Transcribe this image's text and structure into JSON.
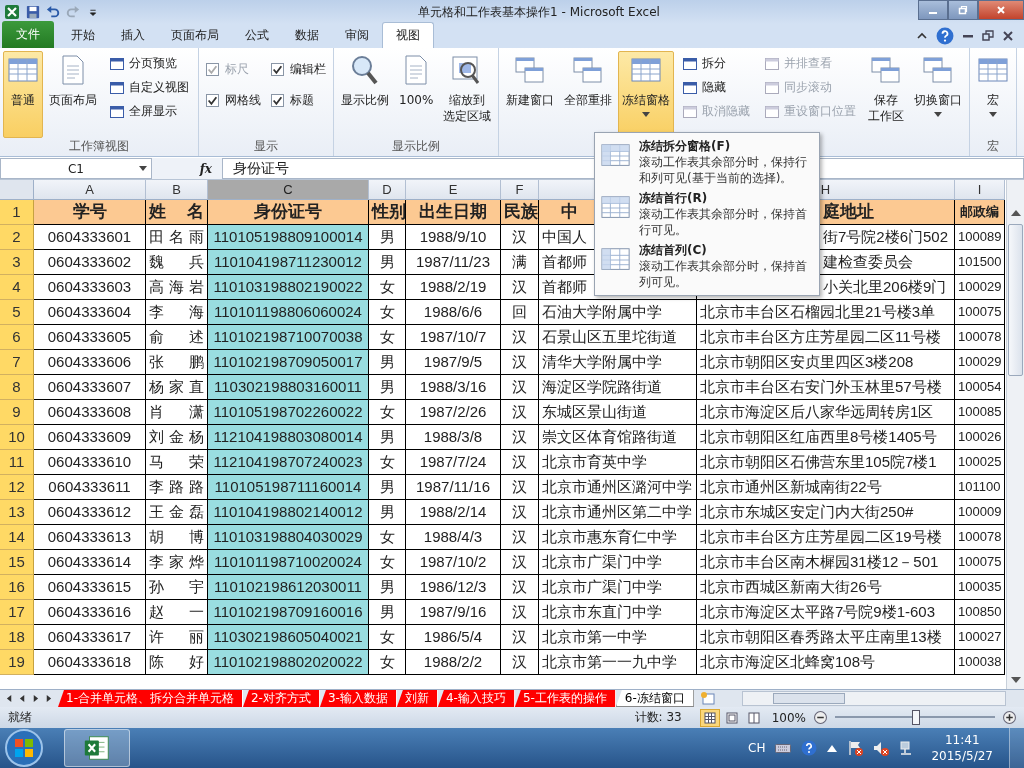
{
  "window": {
    "title": "单元格和工作表基本操作1 - Microsoft Excel"
  },
  "ribbon_tabs": [
    {
      "label": "文件",
      "kind": "file",
      "selected": false
    },
    {
      "label": "开始",
      "kind": "tab",
      "selected": false
    },
    {
      "label": "插入",
      "kind": "tab",
      "selected": false
    },
    {
      "label": "页面布局",
      "kind": "tab",
      "selected": false
    },
    {
      "label": "公式",
      "kind": "tab",
      "selected": false
    },
    {
      "label": "数据",
      "kind": "tab",
      "selected": false
    },
    {
      "label": "审阅",
      "kind": "tab",
      "selected": false
    },
    {
      "label": "视图",
      "kind": "tab",
      "selected": true
    }
  ],
  "ribbon_groups": [
    {
      "label": "工作簿视图",
      "items": [
        {
          "kind": "large",
          "label": "普通",
          "selected": true
        },
        {
          "kind": "large",
          "label": "页面布局",
          "selected": false
        },
        {
          "kind": "stack",
          "items": [
            {
              "label": "分页预览",
              "disabled": false
            },
            {
              "label": "自定义视图",
              "disabled": false
            },
            {
              "label": "全屏显示",
              "disabled": false
            }
          ]
        }
      ]
    },
    {
      "label": "显示",
      "items": [
        {
          "kind": "checks",
          "items": [
            {
              "label": "标尺",
              "checked": true,
              "disabled": true
            },
            {
              "label": "网格线",
              "checked": true,
              "disabled": false
            }
          ]
        },
        {
          "kind": "checks",
          "items": [
            {
              "label": "编辑栏",
              "checked": true,
              "disabled": false
            },
            {
              "label": "标题",
              "checked": true,
              "disabled": false
            }
          ]
        }
      ]
    },
    {
      "label": "显示比例",
      "items": [
        {
          "kind": "large",
          "label": "显示比例",
          "selected": false
        },
        {
          "kind": "large",
          "label": "100%",
          "selected": false
        },
        {
          "kind": "large",
          "label": "缩放到选定区域",
          "selected": false
        }
      ]
    },
    {
      "items": [
        {
          "kind": "large",
          "label": "新建窗口",
          "selected": false
        },
        {
          "kind": "large",
          "label": "全部重排",
          "selected": false
        },
        {
          "kind": "large",
          "label": "冻结窗格",
          "selected": true,
          "dropdown": true
        },
        {
          "kind": "stack",
          "items": [
            {
              "label": "拆分",
              "disabled": false
            },
            {
              "label": "隐藏",
              "disabled": false
            },
            {
              "label": "取消隐藏",
              "disabled": true
            }
          ]
        },
        {
          "kind": "stack",
          "items": [
            {
              "label": "并排查看",
              "disabled": true
            },
            {
              "label": "同步滚动",
              "disabled": true
            },
            {
              "label": "重设窗口位置",
              "disabled": true
            }
          ]
        },
        {
          "kind": "large",
          "label": "保存工作区",
          "selected": false
        },
        {
          "kind": "large",
          "label": "切换窗口",
          "selected": false,
          "dropdown": true
        }
      ]
    },
    {
      "label": "宏",
      "items": [
        {
          "kind": "large",
          "label": "宏",
          "selected": false,
          "dropdown": true
        }
      ]
    }
  ],
  "formula_bar": {
    "name_box": "C1",
    "fx": "fx",
    "value": "身份证号"
  },
  "freeze_menu": [
    {
      "title": "冻结拆分窗格(F)",
      "description": "滚动工作表其余部分时，保持行和列可见(基于当前的选择)。"
    },
    {
      "title": "冻结首行(R)",
      "description": "滚动工作表其余部分时，保持首行可见。"
    },
    {
      "title": "冻结首列(C)",
      "description": "滚动工作表其余部分时，保持首列可见。"
    }
  ],
  "sheet": {
    "columns": [
      {
        "label": "A",
        "selected": false
      },
      {
        "label": "B",
        "selected": false
      },
      {
        "label": "C",
        "selected": true
      },
      {
        "label": "D",
        "selected": false
      },
      {
        "label": "E",
        "selected": false
      },
      {
        "label": "F",
        "selected": false
      },
      {
        "selected": false
      },
      {
        "label": "H",
        "selected": false
      },
      {
        "label": "I",
        "selected": false
      }
    ],
    "rows": [
      {
        "number": "1",
        "kind": "header",
        "cells": [
          "学号",
          "姓名",
          "身份证号",
          "性别",
          "出生日期",
          "民族",
          "中",
          "庭地址",
          "邮政编"
        ]
      },
      {
        "number": "2",
        "kind": "data",
        "cells": [
          "0604333601",
          "田名雨",
          "110105198809100014",
          "男",
          "1988/9/10",
          "汉",
          "中国人",
          "街7号院2楼6门502",
          "100089"
        ]
      },
      {
        "number": "3",
        "kind": "data",
        "cells": [
          "0604333602",
          "魏兵",
          "110104198711230012",
          "男",
          "1987/11/23",
          "满",
          "首都师",
          "建检查委员会",
          "101500"
        ]
      },
      {
        "number": "4",
        "kind": "data",
        "cells": [
          "0604333603",
          "高海岩",
          "110103198802190022",
          "女",
          "1988/2/19",
          "汉",
          "首都师",
          "小关北里206楼9门",
          "100029"
        ]
      },
      {
        "number": "5",
        "kind": "data",
        "cells": [
          "0604333604",
          "李海",
          "110101198806060024",
          "女",
          "1988/6/6",
          "回",
          "石油大学附属中学",
          "北京市丰台区石榴园北里21号楼3单",
          "100075"
        ]
      },
      {
        "number": "6",
        "kind": "data",
        "cells": [
          "0604333605",
          "俞述",
          "110102198710070038",
          "女",
          "1987/10/7",
          "汉",
          "石景山区五里坨街道",
          "北京市丰台区方庄芳星园二区11号楼",
          "100078"
        ]
      },
      {
        "number": "7",
        "kind": "data",
        "cells": [
          "0604333606",
          "张鹏",
          "110102198709050017",
          "男",
          "1987/9/5",
          "汉",
          "清华大学附属中学",
          "北京市朝阳区安贞里四区3楼208",
          "100029"
        ]
      },
      {
        "number": "8",
        "kind": "data",
        "cells": [
          "0604333607",
          "杨家直",
          "110302198803160011",
          "男",
          "1988/3/16",
          "汉",
          "海淀区学院路街道",
          "北京市丰台区右安门外玉林里57号楼",
          "100054"
        ]
      },
      {
        "number": "9",
        "kind": "data",
        "cells": [
          "0604333608",
          "肖潇",
          "110105198702260022",
          "女",
          "1987/2/26",
          "汉",
          "东城区景山街道",
          "北京市海淀区后八家华远周转房1区",
          "100085"
        ]
      },
      {
        "number": "10",
        "kind": "data",
        "cells": [
          "0604333609",
          "刘金杨",
          "112104198803080014",
          "男",
          "1988/3/8",
          "汉",
          "崇文区体育馆路街道",
          "北京市朝阳区红庙西里8号楼1405号",
          "100026"
        ]
      },
      {
        "number": "11",
        "kind": "data",
        "cells": [
          "0604333610",
          "马荣",
          "112104198707240023",
          "女",
          "1987/7/24",
          "汉",
          "北京市育英中学",
          "北京市朝阳区石佛营东里105院7楼1",
          "100025"
        ]
      },
      {
        "number": "12",
        "kind": "data",
        "cells": [
          "0604333611",
          "李路路",
          "110105198711160014",
          "男",
          "1987/11/16",
          "汉",
          "北京市通州区潞河中学",
          "北京市通州区新城南街22号",
          "101100"
        ]
      },
      {
        "number": "13",
        "kind": "data",
        "cells": [
          "0604333612",
          "王金磊",
          "110104198802140012",
          "男",
          "1988/2/14",
          "汉",
          "北京市通州区第二中学",
          "北京市东城区安定门内大街250#",
          "100009"
        ]
      },
      {
        "number": "14",
        "kind": "data",
        "cells": [
          "0604333613",
          "胡博",
          "110103198804030029",
          "女",
          "1988/4/3",
          "汉",
          "北京市惠东育仁中学",
          "北京市丰台区方庄芳星园二区19号楼",
          "100078"
        ]
      },
      {
        "number": "15",
        "kind": "data",
        "cells": [
          "0604333614",
          "李家烨",
          "110101198710020024",
          "女",
          "1987/10/2",
          "汉",
          "北京市广渠门中学",
          "北京市丰台区南木樨园31楼12－501",
          "100075"
        ]
      },
      {
        "number": "16",
        "kind": "data",
        "cells": [
          "0604333615",
          "孙宇",
          "110102198612030011",
          "男",
          "1986/12/3",
          "汉",
          "北京市广渠门中学",
          "北京市西城区新南大街26号",
          "100035"
        ]
      },
      {
        "number": "17",
        "kind": "data",
        "cells": [
          "0604333616",
          "赵一",
          "110102198709160016",
          "男",
          "1987/9/16",
          "汉",
          "北京市东直门中学",
          "北京市海淀区太平路7号院9楼1-603",
          "100850"
        ]
      },
      {
        "number": "18",
        "kind": "data",
        "cells": [
          "0604333617",
          "许丽",
          "110302198605040021",
          "女",
          "1986/5/4",
          "汉",
          "北京市第一中学",
          "北京市朝阳区春秀路太平庄南里13楼",
          "100027"
        ]
      },
      {
        "number": "19",
        "kind": "data",
        "cells": [
          "0604333618",
          "陈好",
          "110102198802020022",
          "女",
          "1988/2/2",
          "汉",
          "北京市第一一九中学",
          "北京市海淀区北蜂窝108号",
          "100038"
        ]
      }
    ]
  },
  "sheet_tabs": [
    {
      "label": "1-合并单元格、拆分合并单元格",
      "color": "#ff0000",
      "selected": false
    },
    {
      "label": "2-对齐方式",
      "color": "#ff0000",
      "selected": false
    },
    {
      "label": "3-输入数据",
      "color": "#ff0000",
      "selected": false
    },
    {
      "label": "刘新",
      "color": "#ff0000",
      "selected": false
    },
    {
      "label": "4-输入技巧",
      "color": "#ff0000",
      "selected": false
    },
    {
      "label": "5-工作表的操作",
      "color": "#ff0000",
      "selected": false
    },
    {
      "label": "6-冻结窗口",
      "selected": true
    }
  ],
  "status_bar": {
    "status": "就绪",
    "count": "计数: 33",
    "view_buttons": [
      {
        "selected": true
      },
      {
        "selected": false
      },
      {
        "selected": false
      }
    ],
    "zoom": "100%",
    "zoom_slider": {
      "level": 0.5
    }
  },
  "taskbar": {
    "language": "CH",
    "time": "11:41",
    "date": "2015/5/27"
  }
}
